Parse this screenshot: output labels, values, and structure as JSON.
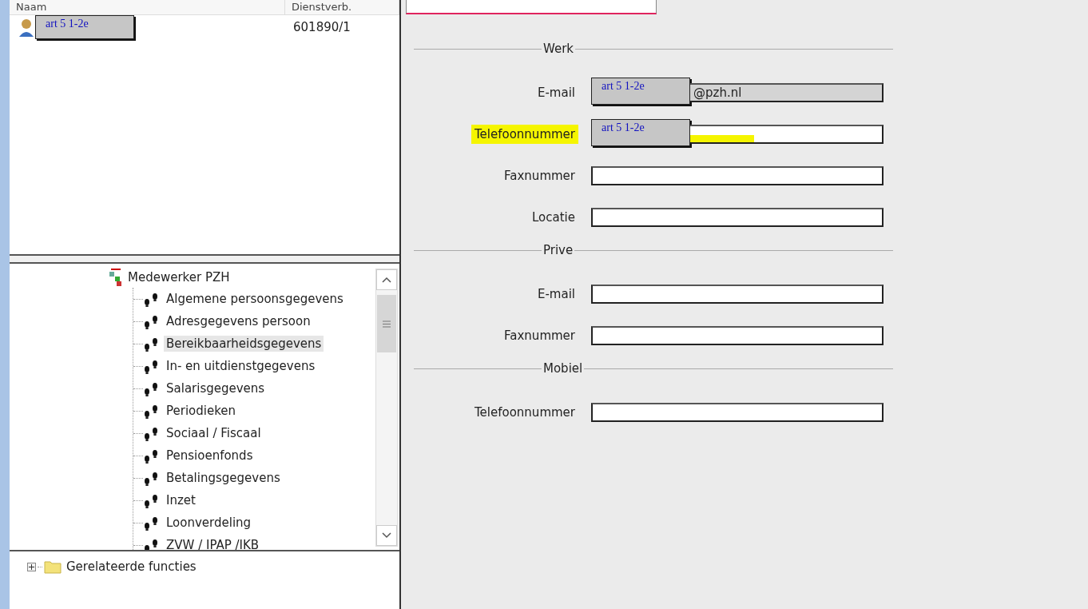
{
  "person_list": {
    "columns": [
      "Naam",
      "Dienstverb."
    ],
    "rows": [
      {
        "redaction": "art 5 1-2e",
        "number": "601890/1",
        "selected": false
      }
    ]
  },
  "tree": {
    "root": "Medewerker PZH",
    "items": [
      {
        "label": "Algemene persoonsgegevens",
        "selected": false
      },
      {
        "label": "Adresgegevens persoon",
        "selected": false
      },
      {
        "label": "Bereikbaarheidsgegevens",
        "selected": true
      },
      {
        "label": "In- en uitdienstgegevens",
        "selected": false
      },
      {
        "label": "Salarisgegevens",
        "selected": false
      },
      {
        "label": "Periodieken",
        "selected": false
      },
      {
        "label": "Sociaal / Fiscaal",
        "selected": false
      },
      {
        "label": "Pensioenfonds",
        "selected": false
      },
      {
        "label": "Betalingsgegevens",
        "selected": false
      },
      {
        "label": "Inzet",
        "selected": false
      },
      {
        "label": "Loonverdeling",
        "selected": false
      },
      {
        "label": "ZVW / IPAP /IKB",
        "selected": false
      }
    ]
  },
  "related": {
    "label": "Gerelateerde functies",
    "expanded": false
  },
  "form": {
    "sections": [
      {
        "title": "Werk",
        "fields": [
          {
            "label": "E-mail",
            "value": "@pzh.nl",
            "disabled": true,
            "highlighted": false,
            "redaction": "art 5 1-2e"
          },
          {
            "label": "Telefoonnummer",
            "disabled": false,
            "highlighted": true,
            "redaction": "art 5 1-2e"
          },
          {
            "label": "Faxnummer",
            "disabled": false,
            "highlighted": false
          },
          {
            "label": "Locatie",
            "disabled": false,
            "highlighted": false
          }
        ]
      },
      {
        "title": "Prive",
        "fields": [
          {
            "label": "E-mail",
            "disabled": false,
            "highlighted": false
          },
          {
            "label": "Faxnummer",
            "disabled": false,
            "highlighted": false
          }
        ]
      },
      {
        "title": "Mobiel",
        "fields": [
          {
            "label": "Telefoonnummer",
            "disabled": false,
            "highlighted": false
          }
        ]
      }
    ]
  }
}
